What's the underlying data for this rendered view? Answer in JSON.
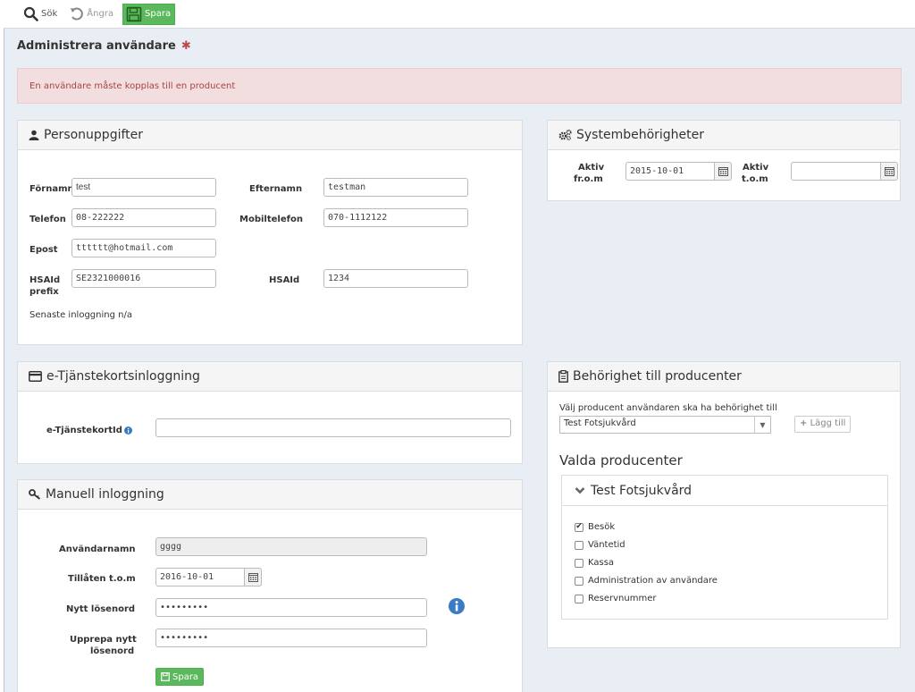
{
  "toolbar": {
    "search_label": "Sök",
    "undo_label": "Ångra",
    "save_label": "Spara"
  },
  "page": {
    "title": "Administrera användare",
    "required_mark": "✱"
  },
  "alert": {
    "text": "En användare måste kopplas till en producent"
  },
  "person": {
    "title": "Personuppgifter",
    "fornamn_label": "Förnamn",
    "fornamn_value": "test",
    "efternamn_label": "Efternamn",
    "efternamn_value": "testman",
    "telefon_label": "Telefon",
    "telefon_value": "08-222222",
    "mobil_label": "Mobiltelefon",
    "mobil_value": "070-1112122",
    "epost_label": "Epost",
    "epost_value": "tttttt@hotmail.com",
    "hsaid_prefix_label_1": "HSAId",
    "hsaid_prefix_label_2": "prefix",
    "hsaid_prefix_value": "SE2321000016",
    "hsaid_label": "HSAId",
    "hsaid_value": "1234",
    "last_login": "Senaste inloggning n/a"
  },
  "system": {
    "title": "Systembehörigheter",
    "from_label_1": "Aktiv",
    "from_label_2": "fr.o.m",
    "from_value": "2015-10-01",
    "to_label_1": "Aktiv",
    "to_label_2": "t.o.m",
    "to_value": ""
  },
  "etj": {
    "title": "e-Tjänstekortsinloggning",
    "id_label": "e-TjänstekortId",
    "id_value": ""
  },
  "manual": {
    "title": "Manuell inloggning",
    "username_label": "Användarnamn",
    "username_value": "gggg",
    "allowed_label": "Tillåten t.o.m",
    "allowed_value": "2016-10-01",
    "newpw_label": "Nytt lösenord",
    "newpw_value": "•••••••••",
    "repeat_label_1": "Upprepa nytt",
    "repeat_label_2": "lösenord",
    "repeat_value": "•••••••••",
    "save_label": "Spara"
  },
  "producer": {
    "title": "Behörighet till producenter",
    "choose_label": "Välj producent användaren ska ha behörighet till",
    "selected_option": "Test Fotsjukvård",
    "add_label": "Lägg till",
    "valda_heading": "Valda producenter",
    "valda_name": "Test Fotsjukvård",
    "permissions": [
      {
        "label": "Besök",
        "checked": true
      },
      {
        "label": "Väntetid",
        "checked": false
      },
      {
        "label": "Kassa",
        "checked": false
      },
      {
        "label": "Administration av användare",
        "checked": false
      },
      {
        "label": "Reservnummer",
        "checked": false
      }
    ]
  }
}
